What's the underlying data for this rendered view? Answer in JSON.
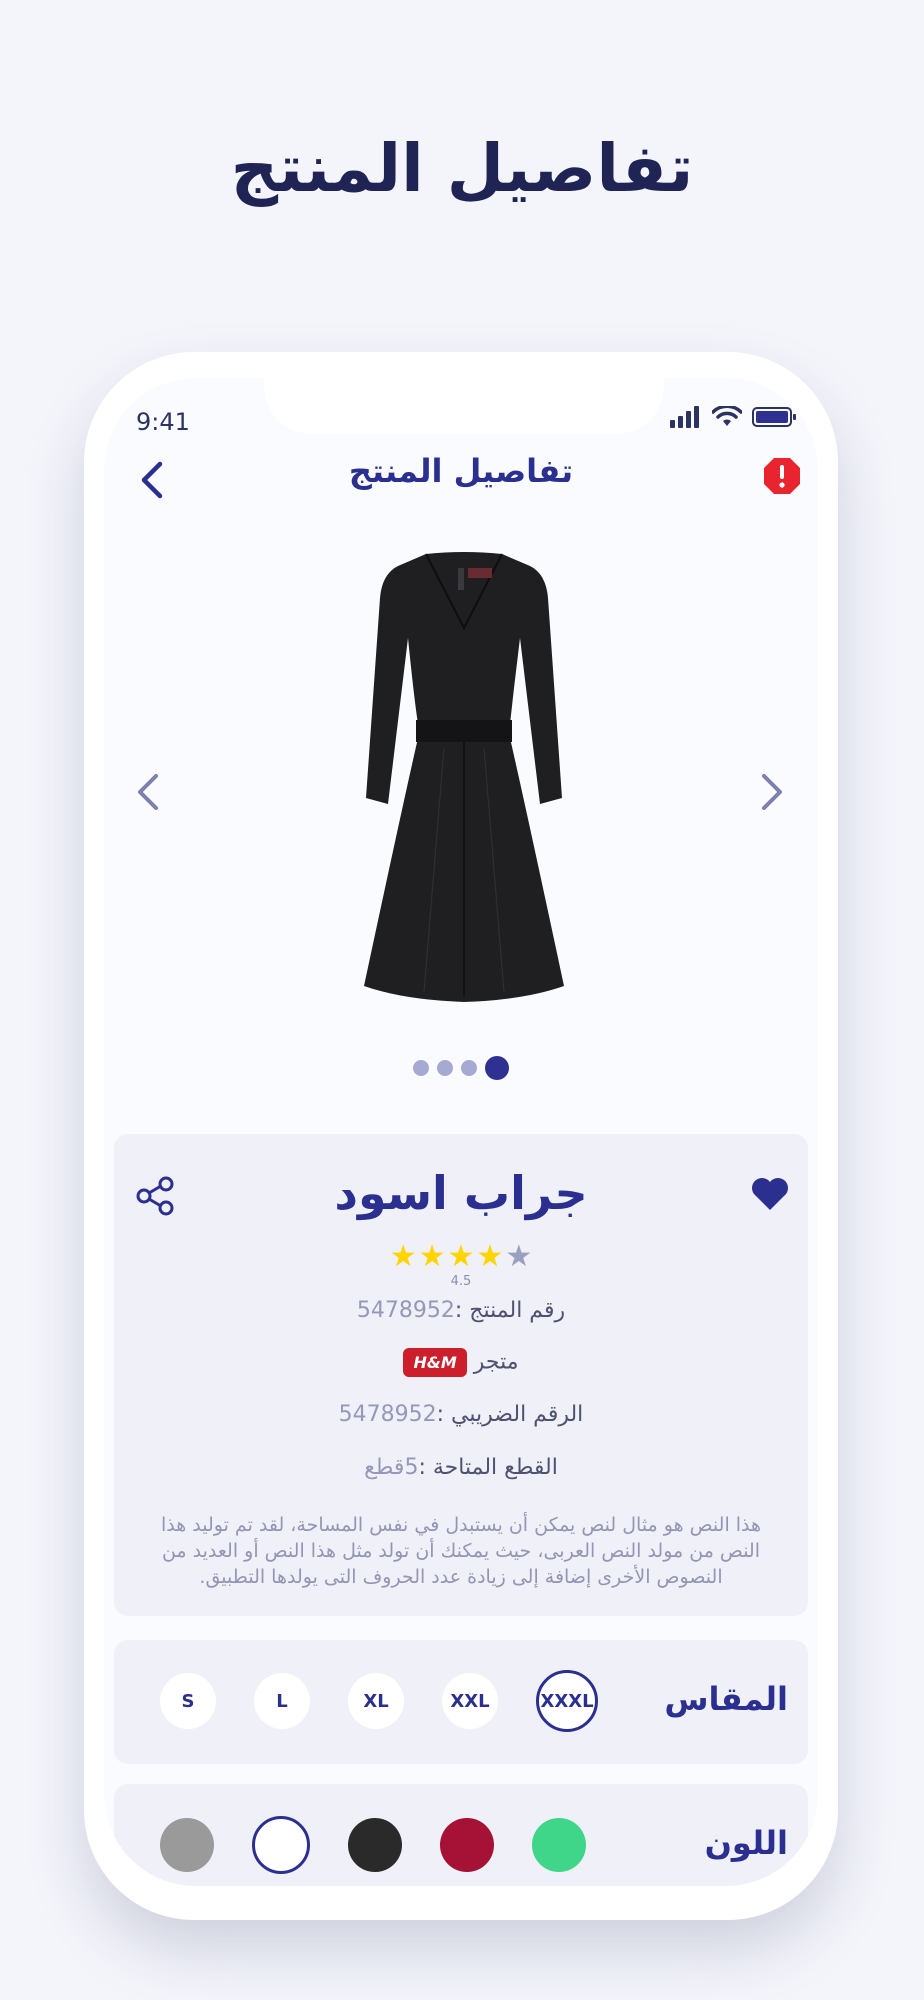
{
  "page_title": "تفاصيل المنتج",
  "status_bar": {
    "time": "9:41"
  },
  "nav": {
    "title": "تفاصيل المنتج"
  },
  "gallery": {
    "dots": 4,
    "active_index": 3
  },
  "product": {
    "name": "جراب اسود",
    "rating": "4.5",
    "rating_value": 4.5,
    "product_number_label": "رقم المنتج :",
    "product_number": "5478952",
    "store_label": "متجر",
    "store_badge": "H&M",
    "tax_label": "الرقم الضريبي :",
    "tax_number": "5478952",
    "stock_label": "القطع المتاحة :",
    "stock_value": "5قطع",
    "description": "هذا النص هو مثال لنص يمكن أن يستبدل في نفس المساحة، لقد تم توليد هذا النص من مولد النص العربى، حيث يمكنك أن تولد مثل هذا النص أو العديد من النصوص الأخرى إضافة إلى زيادة عدد الحروف التى يولدها التطبيق."
  },
  "size_section": {
    "label": "المقاس",
    "options": [
      "S",
      "L",
      "XL",
      "XXL",
      "XXXL"
    ],
    "selected": "XXXL"
  },
  "color_section": {
    "label": "اللون",
    "options": [
      "#9a9a9a",
      "#ffffff",
      "#2a2a2a",
      "#a51236",
      "#3fd68a"
    ],
    "selected_index": 1
  },
  "colors": {
    "primary": "#2b2f8f",
    "star": "#ffd400",
    "report": "#e8242f",
    "brand_badge": "#cc1f2b"
  }
}
